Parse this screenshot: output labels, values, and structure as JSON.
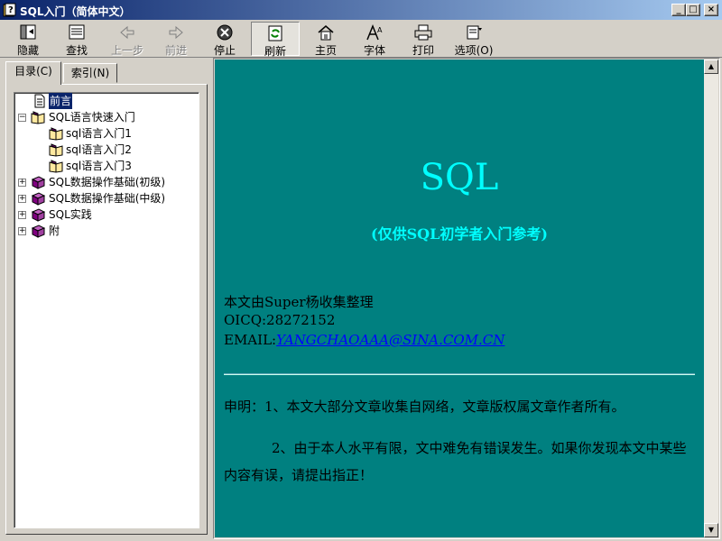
{
  "window": {
    "title": "SQL入门（简体中文）"
  },
  "toolbar": {
    "hide": "隐藏",
    "find": "查找",
    "back": "上一步",
    "forward": "前进",
    "stop": "停止",
    "refresh": "刷新",
    "home": "主页",
    "font": "字体",
    "print": "打印",
    "options": "选项(O)"
  },
  "tabs": {
    "contents": "目录(C)",
    "index": "索引(N)"
  },
  "tree": [
    {
      "label": "前言",
      "selected": true
    },
    {
      "label": "SQL语言快速入门"
    },
    {
      "label": "sql语言入门1"
    },
    {
      "label": "sql语言入门2"
    },
    {
      "label": "sql语言入门3"
    },
    {
      "label": "SQL数据操作基础(初级)"
    },
    {
      "label": "SQL数据操作基础(中级)"
    },
    {
      "label": "SQL实践"
    },
    {
      "label": "附"
    }
  ],
  "content": {
    "title": "SQL",
    "subtitle": "(仅供SQL初学者入门参考)",
    "author_line": "本文由Super杨收集整理",
    "oicq": "OICQ:28272152",
    "email_label": "EMAIL:",
    "email": "YANGCHAOAAA@SINA.COM.CN",
    "para1": "申明：1、本文大部分文章收集自网络，文章版权属文章作者所有。",
    "para2": "2、由于本人水平有限，文中难免有错误发生。如果你发现本文中某些内容有误，请提出指正！"
  },
  "colors": {
    "content_bg": "#008080",
    "title_cyan": "#00ffff",
    "link": "#0000ff"
  }
}
